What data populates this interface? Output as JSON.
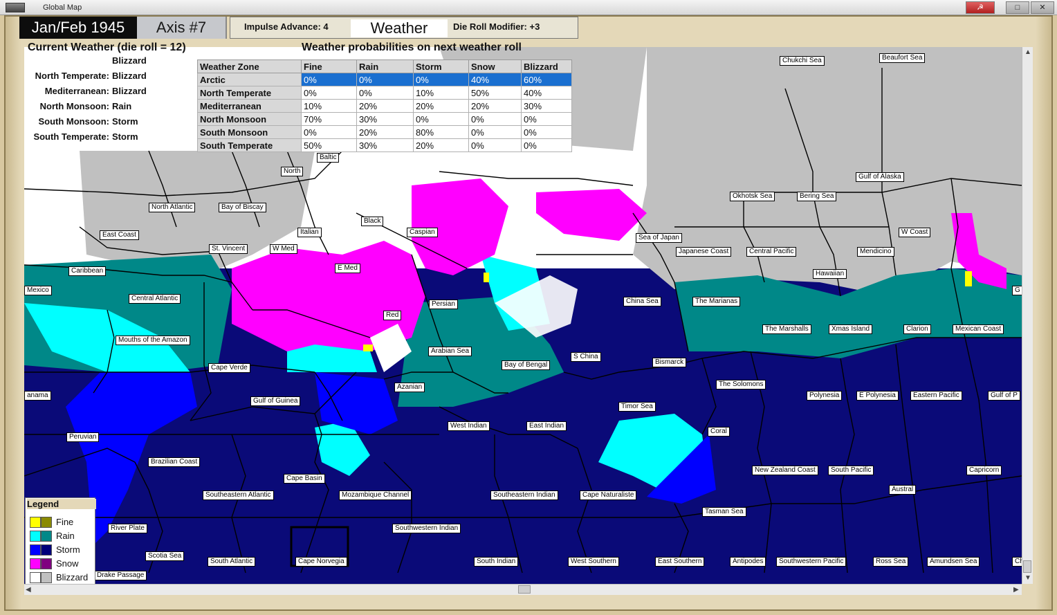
{
  "window": {
    "title": "Global Map"
  },
  "header": {
    "date": "Jan/Feb 1945",
    "impulse": "Axis #7",
    "impulse_advance": "Impulse Advance:  4",
    "weather_button": "Weather",
    "die_roll_modifier": "Die Roll Modifier:  +3"
  },
  "current_weather": {
    "title": "Current Weather (die roll = 12)",
    "rows": [
      {
        "zone": "",
        "value": "Blizzard"
      },
      {
        "zone": "North Temperate:",
        "value": "Blizzard"
      },
      {
        "zone": "Mediterranean:",
        "value": "Blizzard"
      },
      {
        "zone": "North Monsoon:",
        "value": "Rain"
      },
      {
        "zone": "South Monsoon:",
        "value": "Storm"
      },
      {
        "zone": "South Temperate:",
        "value": "Storm"
      }
    ]
  },
  "probabilities": {
    "title": "Weather probabilities on next weather roll",
    "headers": [
      "Weather Zone",
      "Fine",
      "Rain",
      "Storm",
      "Snow",
      "Blizzard"
    ],
    "rows": [
      [
        "Arctic",
        "0%",
        "0%",
        "0%",
        "40%",
        "60%"
      ],
      [
        "North Temperate",
        "0%",
        "0%",
        "10%",
        "50%",
        "40%"
      ],
      [
        "Mediterranean",
        "10%",
        "20%",
        "20%",
        "20%",
        "30%"
      ],
      [
        "North Monsoon",
        "70%",
        "30%",
        "0%",
        "0%",
        "0%"
      ],
      [
        "South Monsoon",
        "0%",
        "20%",
        "80%",
        "0%",
        "0%"
      ],
      [
        "South Temperate",
        "50%",
        "30%",
        "20%",
        "0%",
        "0%"
      ]
    ],
    "selected_row": 0
  },
  "legend": {
    "title": "Legend",
    "items": [
      {
        "label": "Fine",
        "land": "#ffff00",
        "sea": "#8a8a00"
      },
      {
        "label": "Rain",
        "land": "#00ffff",
        "sea": "#008888"
      },
      {
        "label": "Storm",
        "land": "#0000ff",
        "sea": "#00007a"
      },
      {
        "label": "Snow",
        "land": "#ff00ff",
        "sea": "#800080"
      },
      {
        "label": "Blizzard",
        "land": "#ffffff",
        "sea": "#c0c0c0"
      }
    ]
  },
  "map_labels": [
    "Chukchi Sea",
    "Beaufort Sea",
    "Baltic",
    "North",
    "North Atlantic",
    "Bay of Biscay",
    "Gulf of Alaska",
    "Okhotsk Sea",
    "Bering Sea",
    "East Coast",
    "Black",
    "Italian",
    "Caspian",
    "W Coast",
    "Sea of Japan",
    "St. Vincent",
    "W Med",
    "Japanese Coast",
    "Central Pacific",
    "Mendicino",
    "Caribbean",
    "E Med",
    "Hawaiian",
    "Mexico",
    "Central Atlantic",
    "Persian",
    "China Sea",
    "The Marianas",
    "G",
    "Red",
    "The Marshalls",
    "Xmas Island",
    "Clarion",
    "Mexican Coast",
    "Mouths of the Amazon",
    "Arabian Sea",
    "S China",
    "Bismarck",
    "Cape Verde",
    "Bay of Bengal",
    "The Solomons",
    "anama",
    "Azanian",
    "Polynesia",
    "E Polynesia",
    "Eastern Pacific",
    "Gulf of P",
    "Gulf of Guinea",
    "Timor Sea",
    "West Indian",
    "East Indian",
    "Peruvian",
    "Coral",
    "Brazilian Coast",
    "New Zealand Coast",
    "South Pacific",
    "Capricorn",
    "Cape Basin",
    "Austral",
    "Southeastern Atlantic",
    "Mozambique Channel",
    "Southeastern Indian",
    "Cape Naturaliste",
    "Tasman Sea",
    "River Plate",
    "Southwestern Indian",
    "Scotia Sea",
    "South Atlantic",
    "Cape Norvegia",
    "South Indian",
    "West Southern",
    "East Southern",
    "Antipodes",
    "Southwestern Pacific",
    "Ross Sea",
    "Amundsen Sea",
    "Ch",
    "Drake Passage"
  ]
}
